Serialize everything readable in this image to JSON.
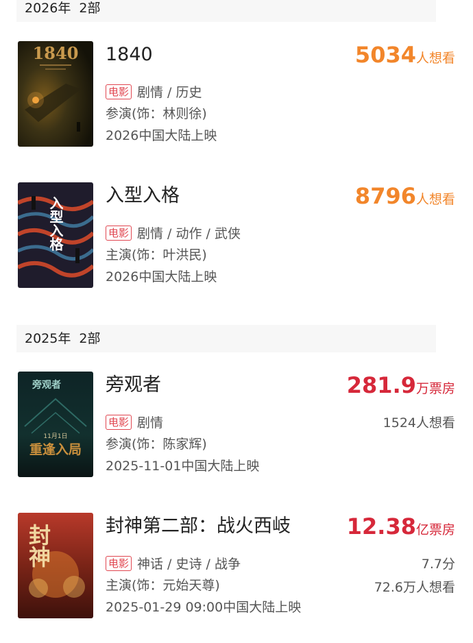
{
  "groups": [
    {
      "year_label": "2026年",
      "count_label": "2部",
      "films": [
        {
          "title": "1840",
          "tag": "电影",
          "genres": "剧情 / 历史",
          "cast": "参演(饰：林则徐)",
          "release": "2026中国大陆上映",
          "stat_number": "5034",
          "stat_unit": "人想看",
          "stat_color": "#f2862b",
          "poster_text": "1840"
        },
        {
          "title": "入型入格",
          "tag": "电影",
          "genres": "剧情 / 动作 / 武侠",
          "cast": "主演(饰：叶洪民)",
          "release": "2026中国大陆上映",
          "stat_number": "8796",
          "stat_unit": "人想看",
          "stat_color": "#f2862b",
          "poster_text": "入型入格"
        }
      ]
    },
    {
      "year_label": "2025年",
      "count_label": "2部",
      "films": [
        {
          "title": "旁观者",
          "tag": "电影",
          "genres": "剧情",
          "cast": "参演(饰：陈家辉)",
          "release": "2025-11-01中国大陆上映",
          "stat_number": "281.9",
          "stat_unit": "万票房",
          "stat_color": "#d6283a",
          "want_to_see": "1524人想看",
          "poster_text": "重逢入局",
          "poster_subtext": "旁观者",
          "poster_date": "11月1日"
        },
        {
          "title": "封神第二部：战火西岐",
          "tag": "电影",
          "genres": "神话 / 史诗 / 战争",
          "cast": "主演(饰：元始天尊)",
          "release": "2025-01-29 09:00中国大陆上映",
          "stat_number": "12.38",
          "stat_unit": "亿票房",
          "stat_color": "#d6283a",
          "rating": "7.7分",
          "want_to_see": "72.6万人想看",
          "poster_text": "封神"
        }
      ]
    }
  ]
}
